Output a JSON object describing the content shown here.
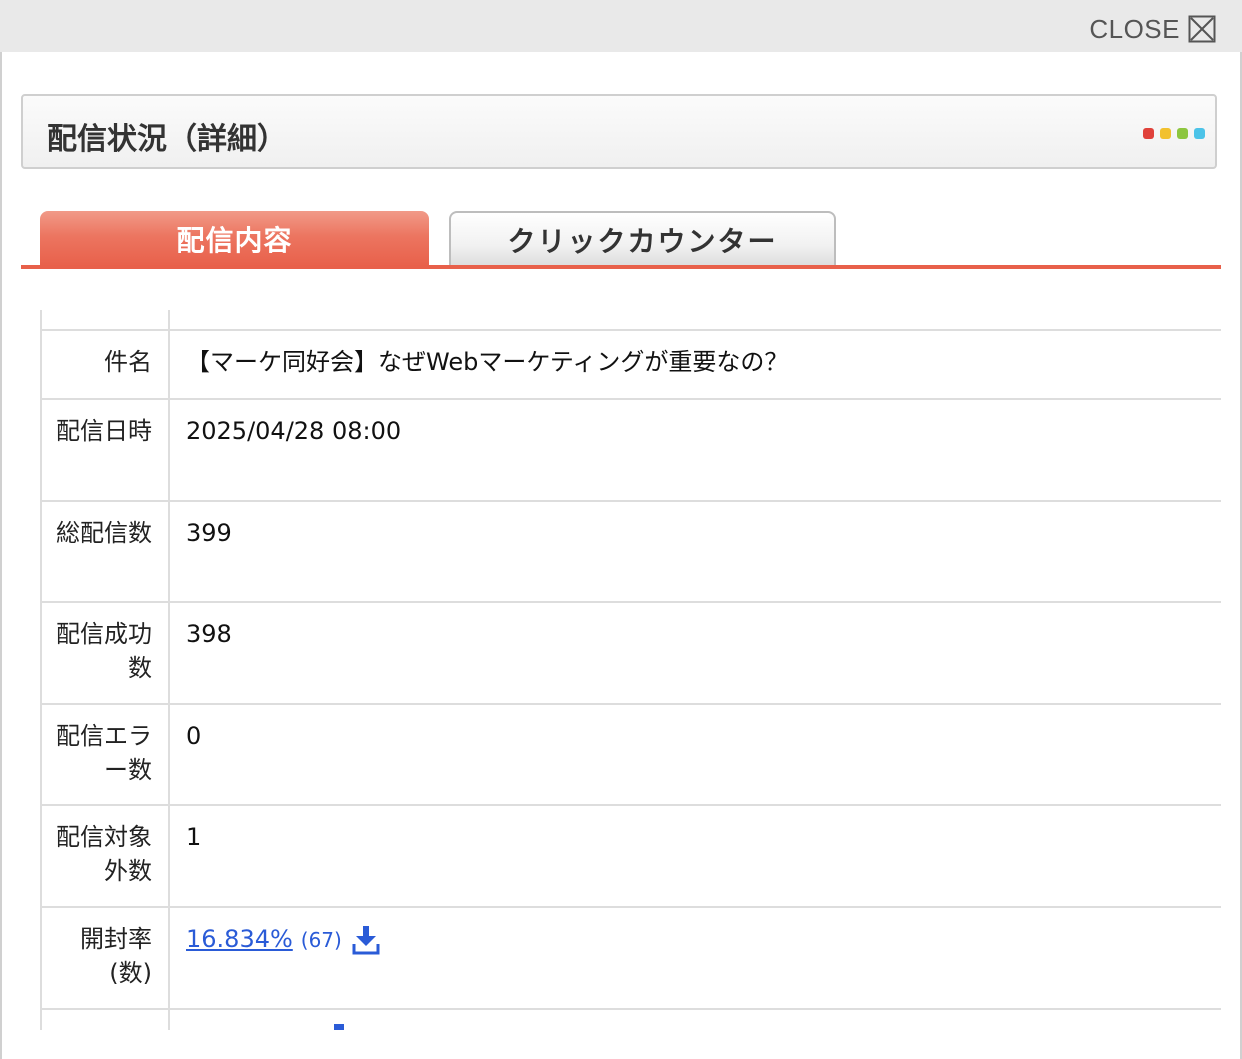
{
  "window": {
    "close_label": "CLOSE",
    "close_icon": "close-box-icon"
  },
  "panel": {
    "title": "配信状況（詳細）",
    "dot_colors": [
      "#e0413a",
      "#f2c12e",
      "#8dc63f",
      "#4cc3e8"
    ]
  },
  "tabs": [
    {
      "label": "配信内容",
      "active": true
    },
    {
      "label": "クリックカウンター",
      "active": false
    }
  ],
  "colors": {
    "accent": "#e8604a",
    "link": "#2a5bd7"
  },
  "rows": [
    {
      "label": "件名",
      "value": "【マーケ同好会】なぜWebマーケティングが重要なの？"
    },
    {
      "label": "配信日時",
      "value": "2025/04/28 08:00"
    },
    {
      "label": "総配信数",
      "value": "399"
    },
    {
      "label": "配信成功数",
      "value": "398"
    },
    {
      "label": "配信エラー数",
      "value": "0"
    },
    {
      "label": "配信対象外数",
      "value": "1"
    },
    {
      "label": "開封率 (数)",
      "rate": "16.834%",
      "count": "(67)",
      "icon": "download-icon"
    }
  ]
}
